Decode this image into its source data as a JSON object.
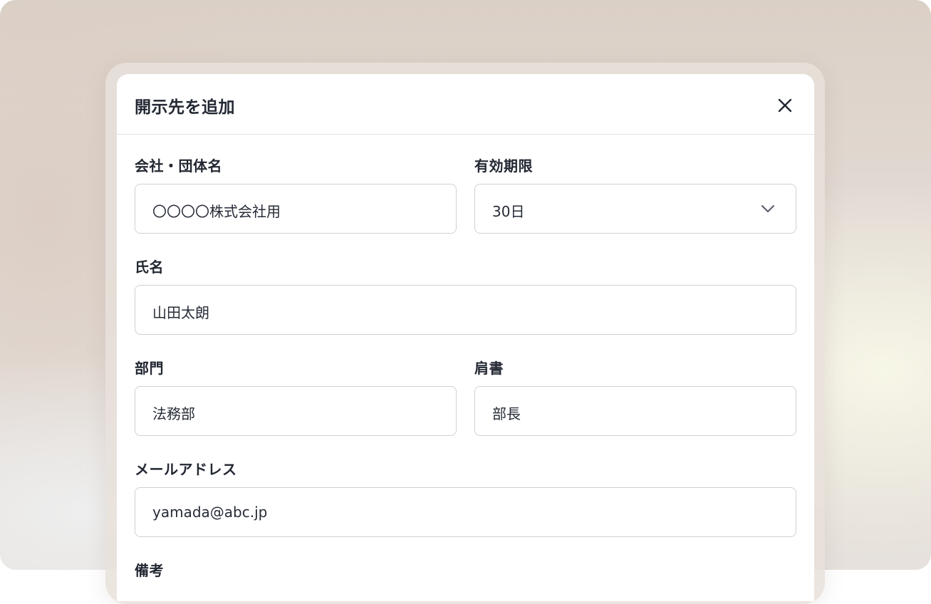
{
  "dialog": {
    "title": "開示先を追加"
  },
  "fields": {
    "company": {
      "label": "会社・団体名",
      "value": "〇〇〇〇株式会社用"
    },
    "expiry": {
      "label": "有効期限",
      "value": "30日"
    },
    "name": {
      "label": "氏名",
      "value": "山田太朗"
    },
    "department": {
      "label": "部門",
      "value": "法務部"
    },
    "title": {
      "label": "肩書",
      "value": "部長"
    },
    "email": {
      "label": "メールアドレス",
      "value": "yamada@abc.jp"
    },
    "notes": {
      "label": "備考"
    }
  },
  "icons": {
    "close": "close-icon",
    "dropdown": "chevron-down-icon"
  }
}
